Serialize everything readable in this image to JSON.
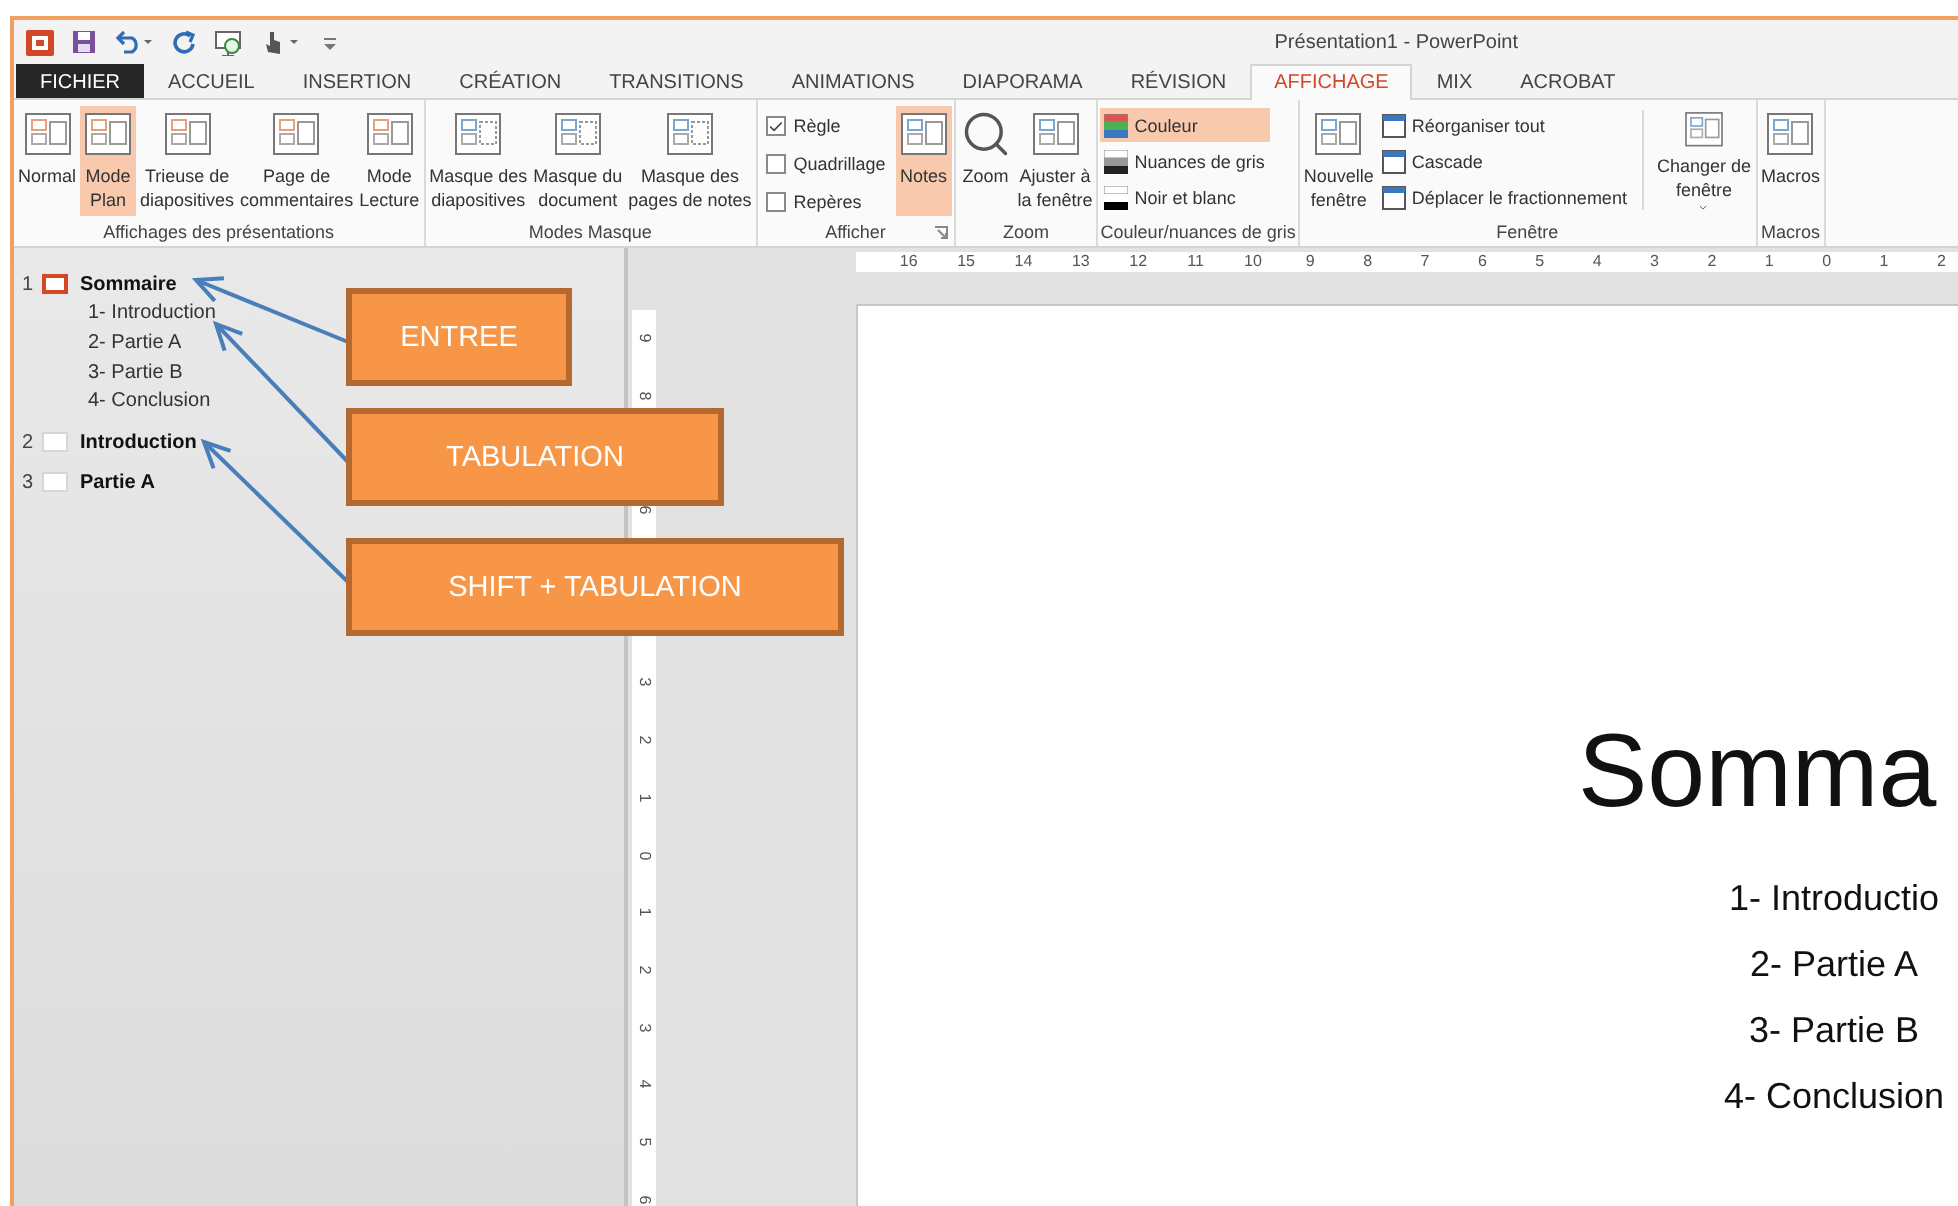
{
  "window": {
    "title": "Présentation1 - PowerPoint"
  },
  "ribbon_tabs": [
    {
      "label": "FICHIER",
      "kind": "file",
      "selected": false
    },
    {
      "label": "ACCUEIL",
      "kind": "tab",
      "selected": false
    },
    {
      "label": "INSERTION",
      "kind": "tab",
      "selected": false
    },
    {
      "label": "CRÉATION",
      "kind": "tab",
      "selected": false
    },
    {
      "label": "TRANSITIONS",
      "kind": "tab",
      "selected": false
    },
    {
      "label": "ANIMATIONS",
      "kind": "tab",
      "selected": false
    },
    {
      "label": "DIAPORAMA",
      "kind": "tab",
      "selected": false
    },
    {
      "label": "RÉVISION",
      "kind": "tab",
      "selected": false
    },
    {
      "label": "AFFICHAGE",
      "kind": "tab",
      "selected": true
    },
    {
      "label": "MIX",
      "kind": "tab",
      "selected": false
    },
    {
      "label": "ACROBAT",
      "kind": "tab",
      "selected": false
    }
  ],
  "ribbon_groups": [
    {
      "label": "Affichages des présentations",
      "items": [
        {
          "kind": "large",
          "label": "Normal",
          "selected": false
        },
        {
          "kind": "large",
          "label": "Mode\nPlan",
          "selected": true
        },
        {
          "kind": "large",
          "label": "Trieuse de\ndiapositives",
          "selected": false
        },
        {
          "kind": "large",
          "label": "Page de\ncommentaires",
          "selected": false
        },
        {
          "kind": "large",
          "label": "Mode\nLecture",
          "selected": false
        }
      ]
    },
    {
      "label": "Modes Masque",
      "items": [
        {
          "kind": "large",
          "label": "Masque des\ndiapositives",
          "selected": false
        },
        {
          "kind": "large",
          "label": "Masque du\ndocument",
          "selected": false
        },
        {
          "kind": "large",
          "label": "Masque des\npages de notes",
          "selected": false
        }
      ]
    },
    {
      "label": "Afficher",
      "launcher": true,
      "items": [
        {
          "kind": "check",
          "label": "Règle",
          "checked": true
        },
        {
          "kind": "check",
          "label": "Quadrillage",
          "checked": false
        },
        {
          "kind": "check",
          "label": "Repères",
          "checked": false
        },
        {
          "kind": "large",
          "label": "Notes",
          "selected": true
        }
      ]
    },
    {
      "label": "Zoom",
      "items": [
        {
          "kind": "large",
          "label": "Zoom",
          "selected": false
        },
        {
          "kind": "large",
          "label": "Ajuster à\nla fenêtre",
          "selected": false
        }
      ]
    },
    {
      "label": "Couleur/nuances de gris",
      "items": [
        {
          "kind": "small",
          "label": "Couleur",
          "selected": true
        },
        {
          "kind": "small",
          "label": "Nuances de gris",
          "selected": false
        },
        {
          "kind": "small",
          "label": "Noir et blanc",
          "selected": false
        }
      ]
    },
    {
      "label": "Fenêtre",
      "items": [
        {
          "kind": "large",
          "label": "Nouvelle\nfenêtre",
          "selected": false
        },
        {
          "kind": "small",
          "label": "Réorganiser tout",
          "selected": false
        },
        {
          "kind": "small",
          "label": "Cascade",
          "selected": false
        },
        {
          "kind": "small",
          "label": "Déplacer le fractionnement",
          "selected": false
        },
        {
          "kind": "separator"
        },
        {
          "kind": "large",
          "label": "Changer de\nfenêtre",
          "selected": false,
          "dropdown": true
        }
      ]
    },
    {
      "label": "Macros",
      "items": [
        {
          "kind": "large",
          "label": "Macros",
          "selected": false
        }
      ]
    }
  ],
  "outline": [
    {
      "number": "1",
      "title": "Sommaire",
      "selected": true,
      "children": [
        {
          "text": "1- Introduction"
        },
        {
          "text": "2- Partie A"
        },
        {
          "text": "3- Partie B"
        },
        {
          "text": "4- Conclusion"
        }
      ]
    },
    {
      "number": "2",
      "title": "Introduction",
      "selected": false
    },
    {
      "number": "3",
      "title": "Partie A",
      "selected": false
    }
  ],
  "callouts": [
    {
      "label": "ENTREE"
    },
    {
      "label": "TABULATION"
    },
    {
      "label": "SHIFT + TABULATION"
    }
  ],
  "horizontal_ruler": [
    "16",
    "15",
    "14",
    "13",
    "12",
    "11",
    "10",
    "9",
    "8",
    "7",
    "6",
    "5",
    "4",
    "3",
    "2",
    "1",
    "0",
    "1",
    "2"
  ],
  "vertical_ruler": [
    {
      "labels": [
        "9",
        "8"
      ]
    },
    {
      "labels": [
        "6"
      ]
    },
    {
      "labels": [
        "3",
        "2",
        "1",
        "0",
        "1",
        "2",
        "3",
        "4",
        "5",
        "6"
      ]
    }
  ],
  "slide": {
    "title": "Somma",
    "items": [
      "1- Introductio",
      "2- Partie A",
      "3- Partie B",
      "4- Conclusion"
    ]
  }
}
